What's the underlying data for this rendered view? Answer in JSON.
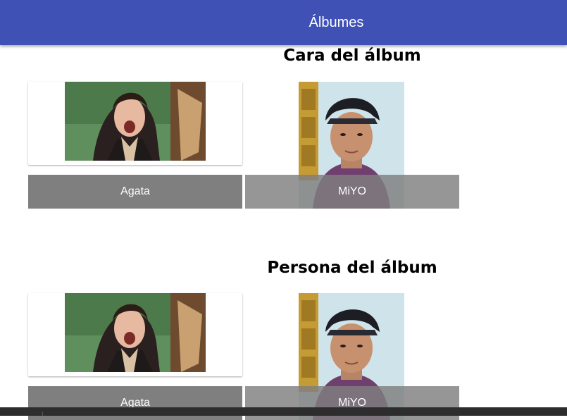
{
  "app_bar": {
    "title": "Álbumes",
    "color": "#3f51b5"
  },
  "sections": [
    {
      "title": "Cara del álbum",
      "albums": [
        {
          "label": "Agata",
          "image": "woman-winking-photo"
        },
        {
          "label": "MiYO",
          "image": "young-man-cap-photo"
        }
      ]
    },
    {
      "title": "Persona del álbum",
      "albums": [
        {
          "label": "Agata",
          "image": "woman-winking-photo"
        },
        {
          "label": "MiYO",
          "image": "young-man-cap-photo"
        }
      ]
    }
  ]
}
